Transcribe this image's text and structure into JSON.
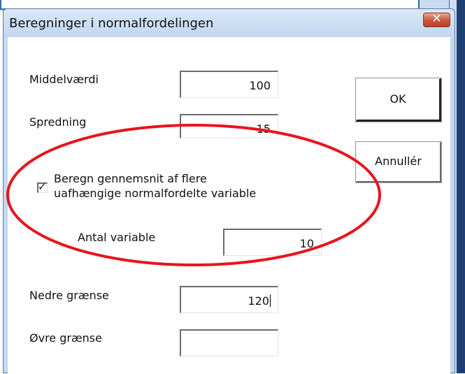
{
  "dialog": {
    "title": "Beregninger i normalfordelingen",
    "close_symbol": "✕"
  },
  "fields": {
    "mean": {
      "label": "Middelværdi",
      "value": "100"
    },
    "spread": {
      "label": "Spredning",
      "value": "15"
    },
    "num_vars": {
      "label": "Antal variable",
      "value": "10"
    },
    "lower": {
      "label": "Nedre grænse",
      "value": "120"
    },
    "upper": {
      "label": "Øvre grænse",
      "value": ""
    }
  },
  "checkbox": {
    "checked": true,
    "mark": "✓",
    "label_line1": "Beregn gennemsnit af flere",
    "label_line2": "uafhængige normalfordelte variable"
  },
  "buttons": {
    "ok": "OK",
    "cancel": "Annullér"
  },
  "annotation": {
    "color": "#e8141c"
  }
}
